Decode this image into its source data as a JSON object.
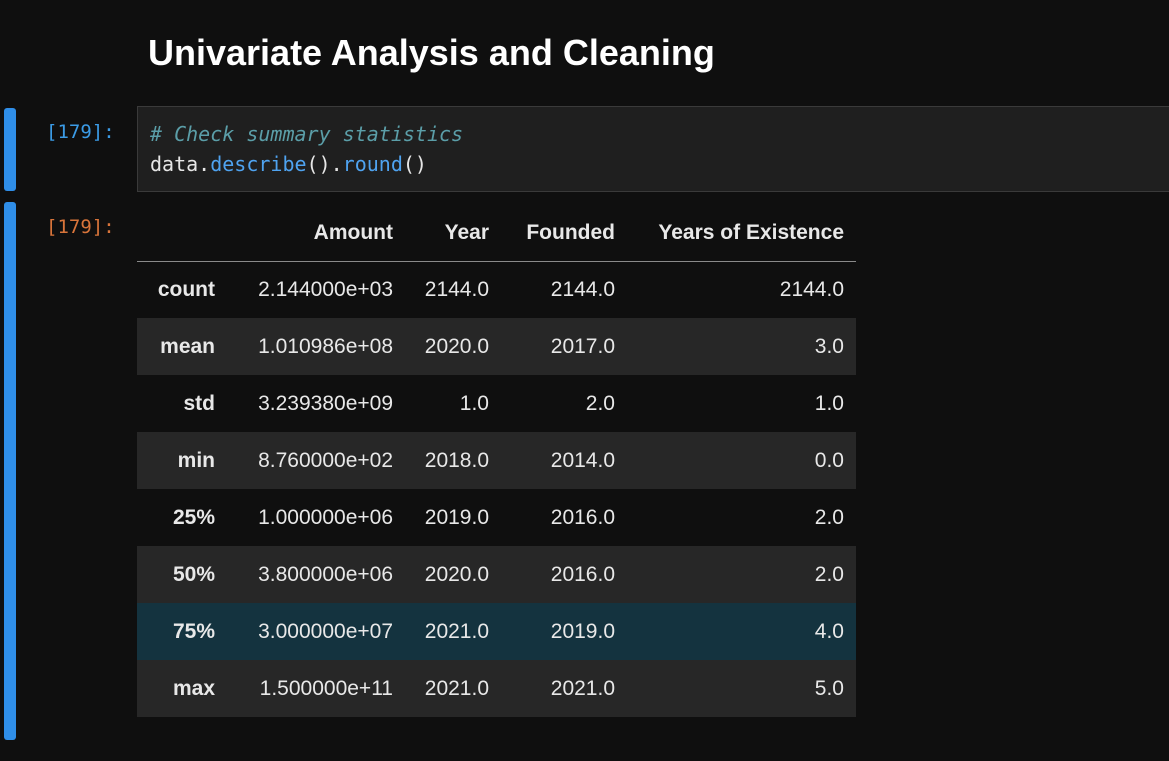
{
  "markdown": {
    "heading": "Univariate Analysis and Cleaning"
  },
  "code_cell": {
    "prompt": "[179]:",
    "comment": "# Check summary statistics",
    "code": {
      "obj": "data.",
      "fn1": "describe",
      "mid": "().",
      "fn2": "round",
      "end": "()"
    }
  },
  "output_cell": {
    "prompt": "[179]:",
    "columns": [
      "",
      "Amount",
      "Year",
      "Founded",
      "Years of Existence"
    ],
    "rows": [
      {
        "label": "count",
        "values": [
          "2.144000e+03",
          "2144.0",
          "2144.0",
          "2144.0"
        ]
      },
      {
        "label": "mean",
        "values": [
          "1.010986e+08",
          "2020.0",
          "2017.0",
          "3.0"
        ]
      },
      {
        "label": "std",
        "values": [
          "3.239380e+09",
          "1.0",
          "2.0",
          "1.0"
        ]
      },
      {
        "label": "min",
        "values": [
          "8.760000e+02",
          "2018.0",
          "2014.0",
          "0.0"
        ]
      },
      {
        "label": "25%",
        "values": [
          "1.000000e+06",
          "2019.0",
          "2016.0",
          "2.0"
        ]
      },
      {
        "label": "50%",
        "values": [
          "3.800000e+06",
          "2020.0",
          "2016.0",
          "2.0"
        ]
      },
      {
        "label": "75%",
        "values": [
          "3.000000e+07",
          "2021.0",
          "2019.0",
          "4.0"
        ]
      },
      {
        "label": "max",
        "values": [
          "1.500000e+11",
          "2021.0",
          "2021.0",
          "5.0"
        ]
      }
    ]
  },
  "colors": {
    "background": "#0f0f0f",
    "cell_indicator": "#2f8ee8",
    "prompt_in": "#3b9be6",
    "prompt_out": "#d8743a",
    "hover_row": "#14333f"
  }
}
